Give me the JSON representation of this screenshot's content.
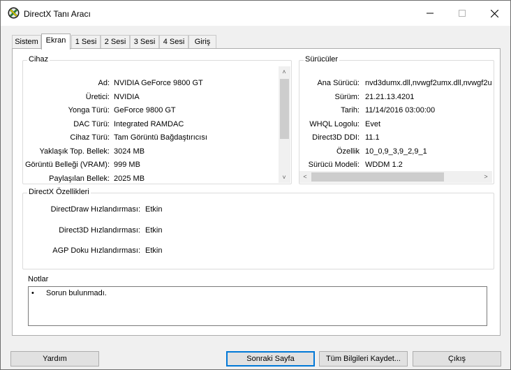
{
  "window": {
    "title": "DirectX Tanı Aracı"
  },
  "tabs": [
    "Sistem",
    "Ekran",
    "1 Sesi",
    "2 Sesi",
    "3 Sesi",
    "4 Sesi",
    "Giriş"
  ],
  "active_tab": "Ekran",
  "device": {
    "label": "Cihaz",
    "rows": [
      {
        "key": "Ad:",
        "value": "NVIDIA GeForce 9800 GT"
      },
      {
        "key": "Üretici:",
        "value": "NVIDIA"
      },
      {
        "key": "Yonga Türü:",
        "value": "GeForce 9800 GT"
      },
      {
        "key": "DAC Türü:",
        "value": "Integrated RAMDAC"
      },
      {
        "key": "Cihaz Türü:",
        "value": "Tam Görüntü Bağdaştırıcısı"
      },
      {
        "key": "Yaklaşık Top. Bellek:",
        "value": "3024 MB"
      },
      {
        "key": "Görüntü Belleği (VRAM):",
        "value": "999 MB"
      },
      {
        "key": "Paylaşılan Bellek:",
        "value": "2025 MB"
      }
    ]
  },
  "drivers": {
    "label": "Sürücüler",
    "rows": [
      {
        "key": "Ana Sürücü:",
        "value": "nvd3dumx.dll,nvwgf2umx.dll,nvwgf2u"
      },
      {
        "key": "Sürüm:",
        "value": "21.21.13.4201"
      },
      {
        "key": "Tarih:",
        "value": "11/14/2016 03:00:00"
      },
      {
        "key": "WHQL Logolu:",
        "value": "Evet"
      },
      {
        "key": "Direct3D DDI:",
        "value": "11.1"
      },
      {
        "key": "Özellik",
        "value": "10_0,9_3,9_2,9_1"
      },
      {
        "key": "Sürücü Modeli:",
        "value": "WDDM 1.2"
      }
    ]
  },
  "features": {
    "label": "DirectX Özellikleri",
    "rows": [
      {
        "key": "DirectDraw Hızlandırması:",
        "value": "Etkin"
      },
      {
        "key": "Direct3D Hızlandırması:",
        "value": "Etkin"
      },
      {
        "key": "AGP Doku Hızlandırması:",
        "value": "Etkin"
      }
    ]
  },
  "notes": {
    "label": "Notlar",
    "items": [
      "Sorun bulunmadı."
    ]
  },
  "buttons": {
    "help": "Yardım",
    "next_page": "Sonraki Sayfa",
    "save_all": "Tüm Bilgileri Kaydet...",
    "exit": "Çıkış"
  }
}
